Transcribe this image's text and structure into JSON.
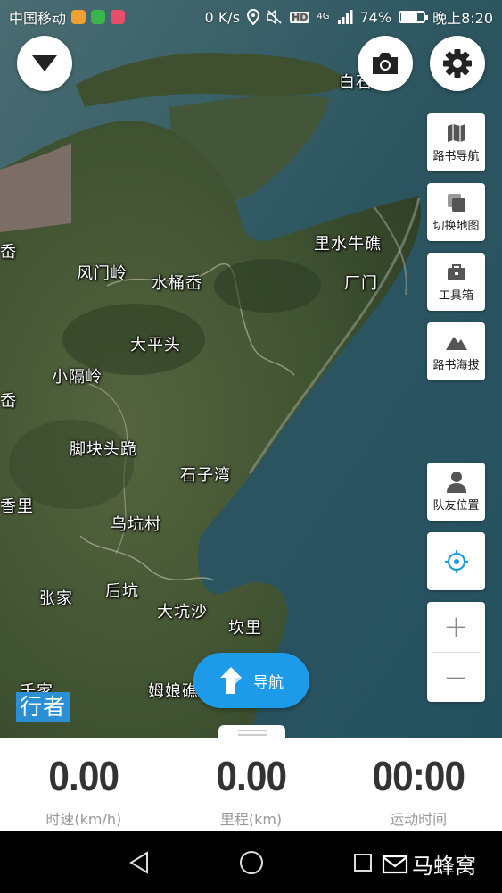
{
  "status_bar": {
    "carrier": "中国移动",
    "speed": "0 K/s",
    "network": "4G",
    "hd": "HD",
    "battery": "74%",
    "battery_level": 0.74,
    "time": "晚上8:20"
  },
  "top_buttons": {
    "dropdown_icon": "triangle-down-icon",
    "camera_icon": "camera-icon",
    "settings_icon": "gear-icon"
  },
  "tools": {
    "roadbook_nav": "路书导航",
    "switch_map": "切换地图",
    "toolbox": "工具箱",
    "roadbook_altitude": "路书海拔",
    "teammate_location": "队友位置"
  },
  "zoom": {
    "in": "+",
    "out": "−"
  },
  "places": {
    "baisha": "白石",
    "cha": "岙",
    "fengmenling": "风门岭",
    "shuitongao": "水桶岙",
    "lishuiniujiao": "里水牛礁",
    "changmen": "厂门",
    "dapingtou": "大平头",
    "xiaoyuling": "小隔岭",
    "ao_left": "岙",
    "jiaokuaitougui": "脚块头跪",
    "shiziwan": "石子湾",
    "li_left": "香里",
    "wukengcun": "乌坑村",
    "zhangjia": "张家",
    "houkeng": "后坑",
    "dakengsha": "大坑沙",
    "kanli": "坎里",
    "maoniang": "姆娘礁",
    "qianjia": "千家"
  },
  "navigate_button": "导航",
  "logo_text": "行者",
  "stats": {
    "speed": {
      "value": "0.00",
      "label": "时速(km/h)"
    },
    "distance": {
      "value": "0.00",
      "label": "里程(km)"
    },
    "time": {
      "value": "00:00",
      "label": "运动时间"
    }
  },
  "watermark_brand": "马蜂窝"
}
